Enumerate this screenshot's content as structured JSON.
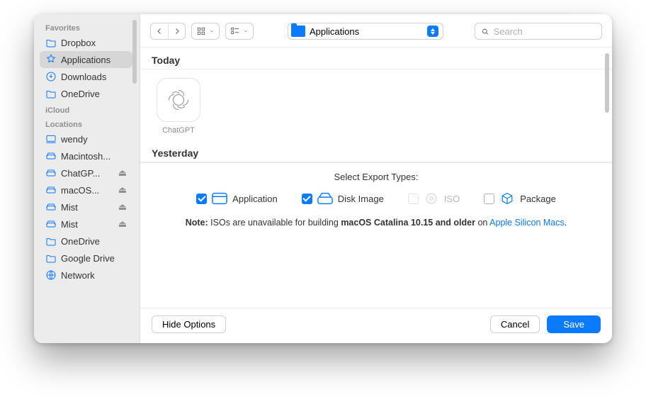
{
  "sidebar": {
    "sections": {
      "favorites": {
        "title": "Favorites",
        "items": [
          {
            "label": "Dropbox"
          },
          {
            "label": "Applications",
            "selected": true
          },
          {
            "label": "Downloads"
          },
          {
            "label": "OneDrive"
          }
        ]
      },
      "icloud": {
        "title": "iCloud",
        "items": []
      },
      "locations": {
        "title": "Locations",
        "items": [
          {
            "label": "wendy"
          },
          {
            "label": "Macintosh..."
          },
          {
            "label": "ChatGP...",
            "eject": true
          },
          {
            "label": "macOS...",
            "eject": true
          },
          {
            "label": "Mist",
            "eject": true
          },
          {
            "label": "Mist",
            "eject": true
          },
          {
            "label": "OneDrive"
          },
          {
            "label": "Google Drive"
          },
          {
            "label": "Network"
          }
        ]
      }
    }
  },
  "toolbar": {
    "location_label": "Applications",
    "search_placeholder": "Search"
  },
  "browser": {
    "sections": [
      {
        "title": "Today",
        "files": [
          {
            "name": "ChatGPT"
          }
        ]
      },
      {
        "title": "Yesterday",
        "files": []
      }
    ]
  },
  "export": {
    "title": "Select Export Types:",
    "types": [
      {
        "label": "Application",
        "checked": true,
        "enabled": true
      },
      {
        "label": "Disk Image",
        "checked": true,
        "enabled": true
      },
      {
        "label": "ISO",
        "checked": false,
        "enabled": false
      },
      {
        "label": "Package",
        "checked": false,
        "enabled": true
      }
    ],
    "note_prefix": "Note:",
    "note_mid1": " ISOs are unavailable for building ",
    "note_bold": "macOS Catalina 10.15 and older",
    "note_mid2": " on ",
    "note_link": "Apple Silicon Macs",
    "note_suffix": "."
  },
  "footer": {
    "hide_options": "Hide Options",
    "cancel": "Cancel",
    "save": "Save"
  }
}
